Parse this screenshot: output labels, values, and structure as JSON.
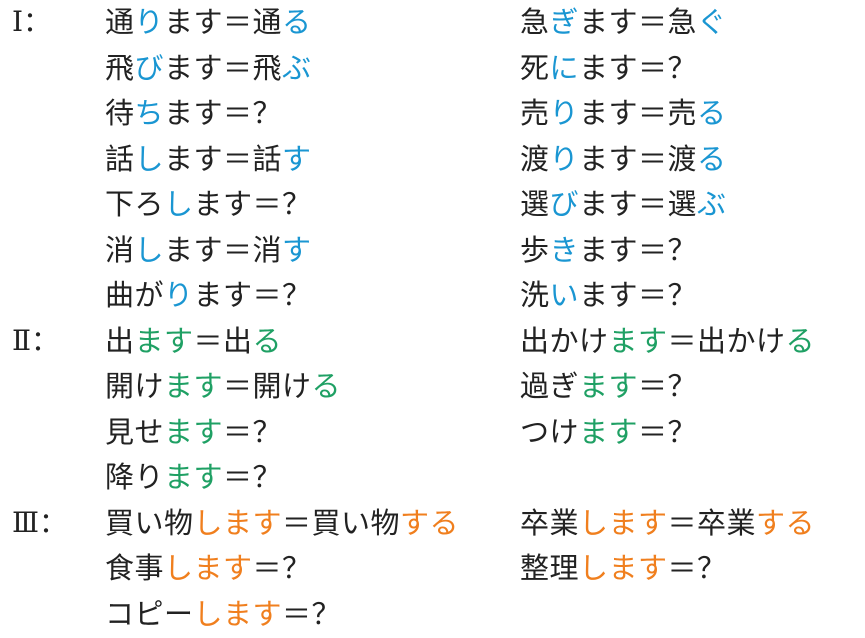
{
  "colors": {
    "text": "#222222",
    "group1": "#1a96d2",
    "group2": "#1fa064",
    "group3": "#f07f1e"
  },
  "groups": [
    {
      "marker": "Ⅰ：",
      "color_key": "group1",
      "left": [
        [
          {
            "t": "通"
          },
          {
            "t": "り",
            "c": 1
          },
          {
            "t": "ます＝通"
          },
          {
            "t": "る",
            "c": 1
          }
        ],
        [
          {
            "t": "飛"
          },
          {
            "t": "び",
            "c": 1
          },
          {
            "t": "ます＝飛"
          },
          {
            "t": "ぶ",
            "c": 1
          }
        ],
        [
          {
            "t": "待"
          },
          {
            "t": "ち",
            "c": 1
          },
          {
            "t": "ます＝？"
          }
        ],
        [
          {
            "t": "話"
          },
          {
            "t": "し",
            "c": 1
          },
          {
            "t": "ます＝話"
          },
          {
            "t": "す",
            "c": 1
          }
        ],
        [
          {
            "t": "下ろ"
          },
          {
            "t": "し",
            "c": 1
          },
          {
            "t": "ます＝？"
          }
        ],
        [
          {
            "t": "消"
          },
          {
            "t": "し",
            "c": 1
          },
          {
            "t": "ます＝消"
          },
          {
            "t": "す",
            "c": 1
          }
        ],
        [
          {
            "t": "曲が"
          },
          {
            "t": "り",
            "c": 1
          },
          {
            "t": "ます＝？"
          }
        ]
      ],
      "right": [
        [
          {
            "t": "急"
          },
          {
            "t": "ぎ",
            "c": 1
          },
          {
            "t": "ます＝急"
          },
          {
            "t": "ぐ",
            "c": 1
          }
        ],
        [
          {
            "t": "死"
          },
          {
            "t": "に",
            "c": 1
          },
          {
            "t": "ます＝？"
          }
        ],
        [
          {
            "t": "売"
          },
          {
            "t": "り",
            "c": 1
          },
          {
            "t": "ます＝売"
          },
          {
            "t": "る",
            "c": 1
          }
        ],
        [
          {
            "t": "渡"
          },
          {
            "t": "り",
            "c": 1
          },
          {
            "t": "ます＝渡"
          },
          {
            "t": "る",
            "c": 1
          }
        ],
        [
          {
            "t": "選"
          },
          {
            "t": "び",
            "c": 1
          },
          {
            "t": "ます＝選"
          },
          {
            "t": "ぶ",
            "c": 1
          }
        ],
        [
          {
            "t": "歩"
          },
          {
            "t": "き",
            "c": 1
          },
          {
            "t": "ます＝？"
          }
        ],
        [
          {
            "t": "洗"
          },
          {
            "t": "い",
            "c": 1
          },
          {
            "t": "ます＝？"
          }
        ]
      ]
    },
    {
      "marker": "Ⅱ：",
      "color_key": "group2",
      "left": [
        [
          {
            "t": "出"
          },
          {
            "t": "ます",
            "c": 1
          },
          {
            "t": "＝出"
          },
          {
            "t": "る",
            "c": 1
          }
        ],
        [
          {
            "t": "開け"
          },
          {
            "t": "ます",
            "c": 1
          },
          {
            "t": "＝開け"
          },
          {
            "t": "る",
            "c": 1
          }
        ],
        [
          {
            "t": "見せ"
          },
          {
            "t": "ます",
            "c": 1
          },
          {
            "t": "＝？"
          }
        ],
        [
          {
            "t": "降り"
          },
          {
            "t": "ます",
            "c": 1
          },
          {
            "t": "＝？"
          }
        ]
      ],
      "right": [
        [
          {
            "t": "出かけ"
          },
          {
            "t": "ます",
            "c": 1
          },
          {
            "t": "＝出かけ"
          },
          {
            "t": "る",
            "c": 1
          }
        ],
        [
          {
            "t": "過ぎ"
          },
          {
            "t": "ます",
            "c": 1
          },
          {
            "t": "＝？"
          }
        ],
        [
          {
            "t": "つけ"
          },
          {
            "t": "ます",
            "c": 1
          },
          {
            "t": "＝？"
          }
        ]
      ]
    },
    {
      "marker": "Ⅲ：",
      "color_key": "group3",
      "left": [
        [
          {
            "t": "買い物"
          },
          {
            "t": "します",
            "c": 1
          },
          {
            "t": "＝買い物"
          },
          {
            "t": "する",
            "c": 1
          }
        ],
        [
          {
            "t": "食事"
          },
          {
            "t": "します",
            "c": 1
          },
          {
            "t": "＝？"
          }
        ],
        [
          {
            "t": "コピー"
          },
          {
            "t": "します",
            "c": 1
          },
          {
            "t": "＝？"
          }
        ]
      ],
      "right": [
        [
          {
            "t": "卒業"
          },
          {
            "t": "します",
            "c": 1
          },
          {
            "t": "＝卒業"
          },
          {
            "t": "する",
            "c": 1
          }
        ],
        [
          {
            "t": "整理"
          },
          {
            "t": "します",
            "c": 1
          },
          {
            "t": "＝？"
          }
        ]
      ]
    }
  ]
}
